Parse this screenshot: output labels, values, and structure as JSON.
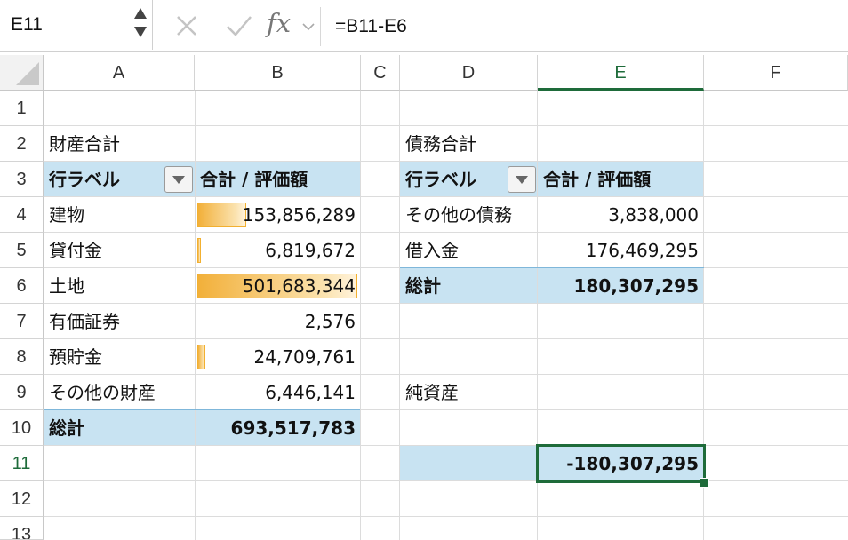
{
  "name_box": {
    "value": "E11"
  },
  "formula_bar": {
    "fx_label": "fx",
    "formula": "=B11-E6"
  },
  "columns": [
    "A",
    "B",
    "C",
    "D",
    "E",
    "F"
  ],
  "rows": [
    "1",
    "2",
    "3",
    "4",
    "5",
    "6",
    "7",
    "8",
    "9",
    "10",
    "11",
    "12",
    "13"
  ],
  "active_cell": {
    "column": "E",
    "row": "11"
  },
  "left_pivot": {
    "title": "財産合計",
    "header_row_label": "行ラベル",
    "header_value": "合計 / 評価額",
    "items": [
      {
        "label": "建物",
        "value": "153,856,289",
        "bar_fraction": 0.307
      },
      {
        "label": "貸付金",
        "value": "6,819,672",
        "bar_fraction": 0.014
      },
      {
        "label": "土地",
        "value": "501,683,344",
        "bar_fraction": 1.0
      },
      {
        "label": "有価証券",
        "value": "2,576",
        "bar_fraction": 0.0
      },
      {
        "label": "預貯金",
        "value": "24,709,761",
        "bar_fraction": 0.049
      },
      {
        "label": "その他の財産",
        "value": "6,446,141",
        "bar_fraction": 0.0
      }
    ],
    "total_label": "総計",
    "total_value": "693,517,783"
  },
  "right_pivot": {
    "title": "債務合計",
    "header_row_label": "行ラベル",
    "header_value": "合計 / 評価額",
    "items": [
      {
        "label": "その他の債務",
        "value": "3,838,000"
      },
      {
        "label": "借入金",
        "value": "176,469,295"
      }
    ],
    "total_label": "総計",
    "total_value": "180,307,295"
  },
  "net_assets": {
    "label": "純資産",
    "value": "-180,307,295"
  },
  "colors": {
    "accent_green": "#1e6b3a",
    "pivot_band": "#c8e3f2",
    "databar": "#f2b03a"
  }
}
